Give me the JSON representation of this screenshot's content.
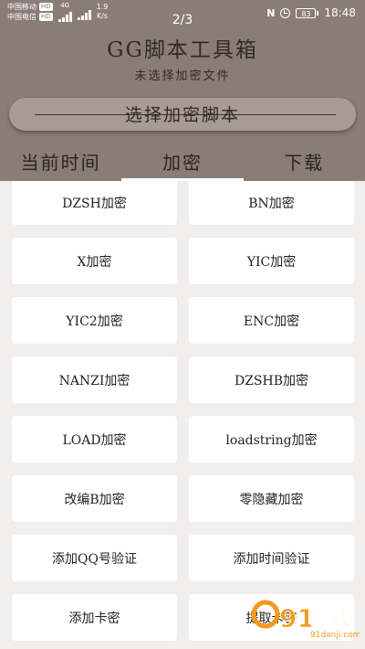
{
  "status_bar": {
    "carrier_1": "中国移动",
    "carrier_2": "中国电信",
    "hd_badge": "HD",
    "net_type": "4G",
    "net_speed_value": "1.9",
    "net_speed_unit": "K/s",
    "page_indicator": "2/3",
    "battery": "83",
    "time": "18:48"
  },
  "header": {
    "title": "GG脚本工具箱",
    "subtitle": "未选择加密文件",
    "select_button_label": "选择加密脚本"
  },
  "tabs": [
    {
      "label": "当前时间",
      "active": false
    },
    {
      "label": "加密",
      "active": true
    },
    {
      "label": "下载",
      "active": false
    }
  ],
  "options": [
    {
      "label": "DZSH加密"
    },
    {
      "label": "BN加密"
    },
    {
      "label": "X加密"
    },
    {
      "label": "YIC加密"
    },
    {
      "label": "YIC2加密"
    },
    {
      "label": "ENC加密"
    },
    {
      "label": "NANZI加密"
    },
    {
      "label": "DZSHB加密"
    },
    {
      "label": "LOAD加密"
    },
    {
      "label": "loadstring加密"
    },
    {
      "label": "改编B加密"
    },
    {
      "label": "零隐藏加密"
    },
    {
      "label": "添加QQ号验证"
    },
    {
      "label": "添加时间验证"
    },
    {
      "label": "添加卡密"
    },
    {
      "label": "提取卡密"
    }
  ],
  "watermark": {
    "number": "91",
    "text": "游戏",
    "url": "91danji.com"
  },
  "colors": {
    "header_bg": "#8a7d78",
    "body_bg": "#f1eeee",
    "tab_indicator": "#ffffff",
    "watermark_orange": "#f39a1c"
  }
}
